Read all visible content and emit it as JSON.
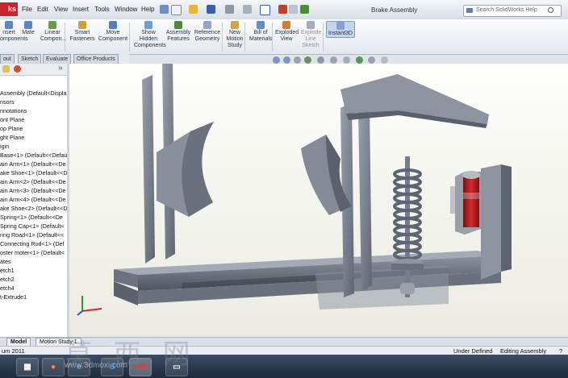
{
  "app": {
    "logo_text": "ks",
    "document_title": "Brake Assembly"
  },
  "menu": [
    "File",
    "Edit",
    "View",
    "Insert",
    "Tools",
    "Window",
    "Help"
  ],
  "search": {
    "placeholder": "Search SolidWorks Help"
  },
  "ribbon": [
    {
      "label": "nsert\nomponents",
      "icon": "insert-components-icon",
      "state": "normal"
    },
    {
      "label": "Mate",
      "icon": "mate-icon",
      "state": "normal"
    },
    {
      "label": "Linear\nCompon...",
      "icon": "linear-pattern-icon",
      "state": "normal"
    },
    {
      "label": "Smart\nFasteners",
      "icon": "smart-fasteners-icon",
      "state": "normal"
    },
    {
      "label": "Move\nComponent",
      "icon": "move-component-icon",
      "state": "normal"
    },
    {
      "label": "Show\nHidden\nComponents",
      "icon": "show-hidden-icon",
      "state": "normal"
    },
    {
      "label": "Assembly\nFeatures",
      "icon": "assembly-features-icon",
      "state": "normal"
    },
    {
      "label": "Reference\nGeometry",
      "icon": "reference-geometry-icon",
      "state": "normal"
    },
    {
      "label": "New\nMotion\nStudy",
      "icon": "motion-study-icon",
      "state": "normal"
    },
    {
      "label": "Bill of\nMaterials",
      "icon": "bom-icon",
      "state": "normal"
    },
    {
      "label": "Exploded\nView",
      "icon": "exploded-view-icon",
      "state": "normal"
    },
    {
      "label": "Explode\nLine\nSketch",
      "icon": "explode-line-icon",
      "state": "disabled"
    },
    {
      "label": "Instant3D",
      "icon": "instant3d-icon",
      "state": "active"
    }
  ],
  "tabs": [
    "out",
    "Sketch",
    "Evaluate",
    "Office Products"
  ],
  "feature_tree": [
    "Assembly  (Default<Displa",
    "nsors",
    "nnotations",
    "ont Plane",
    "op Plane",
    "ght Plane",
    "igin",
    " Base<1> (Default<<Defau",
    "ain Arm<1> (Default<<De",
    "ake Shoe<1> (Default<<D",
    "ain Arm<2> (Default<<De",
    "ain Arm<3> (Default<<De",
    "ain Arm<4> (Default<<De",
    "ake Shoe<2> (Default<<D",
    " Spring<1> (Default<<De",
    " Spring Cap<1> (Default<",
    "ring Road<1> (Default<<",
    " Connecting Rod<1> (Def",
    "oster moter<1> (Default<",
    "ates",
    "etch1",
    "etch2",
    "etch4",
    "t-Extrude1"
  ],
  "bottom_tabs": [
    "Model",
    "Motion Study 1"
  ],
  "status": {
    "left": "um 2011",
    "state": "Under Defined",
    "mode": "Editing Assembly",
    "help": "?"
  },
  "watermark": {
    "text": "莫 西 网",
    "url": "www.3dmoxi.com"
  },
  "colors": {
    "accent": "#c9242c",
    "model_metal": "#7d8492",
    "motor_red": "#c21f1f"
  }
}
